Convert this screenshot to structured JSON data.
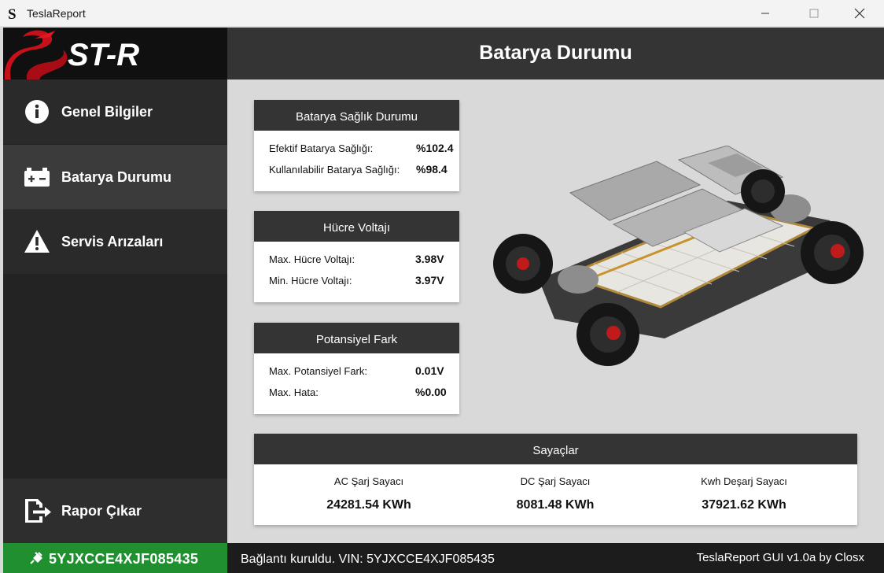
{
  "window": {
    "title": "TeslaReport"
  },
  "sidebar": {
    "logo_text": "ST-R",
    "items": [
      {
        "label": "Genel Bilgiler",
        "icon": "info-icon"
      },
      {
        "label": "Batarya Durumu",
        "icon": "battery-icon"
      },
      {
        "label": "Servis Arızaları",
        "icon": "warning-icon"
      }
    ],
    "report": {
      "label": "Rapor Çıkar",
      "icon": "export-icon"
    },
    "vin": {
      "label": "5YJXCCE4XJF085435",
      "icon": "plug-icon"
    }
  },
  "header": {
    "title": "Batarya Durumu"
  },
  "cards": {
    "health": {
      "title": "Batarya Sağlık Durumu",
      "rows": [
        {
          "label": "Efektif Batarya Sağlığı:",
          "value": "%102.4"
        },
        {
          "label": "Kullanılabilir Batarya Sağlığı:",
          "value": "%98.4"
        }
      ]
    },
    "voltage": {
      "title": "Hücre Voltajı",
      "rows": [
        {
          "label": "Max. Hücre Voltajı:",
          "value": "3.98V"
        },
        {
          "label": "Min. Hücre Voltajı:",
          "value": "3.97V"
        }
      ]
    },
    "potential": {
      "title": "Potansiyel Fark",
      "rows": [
        {
          "label": "Max. Potansiyel Fark:",
          "value": "0.01V"
        },
        {
          "label": "Max. Hata:",
          "value": "%0.00"
        }
      ]
    }
  },
  "counters": {
    "title": "Sayaçlar",
    "items": [
      {
        "label": "AC Şarj Sayacı",
        "value": "24281.54 KWh"
      },
      {
        "label": "DC Şarj Sayacı",
        "value": "8081.48 KWh"
      },
      {
        "label": "Kwh Deşarj Sayacı",
        "value": "37921.62 KWh"
      }
    ]
  },
  "status": {
    "left": "Bağlantı kuruldu. VIN: 5YJXCCE4XJF085435",
    "right": "TeslaReport GUI v1.0a by Closx"
  },
  "colors": {
    "accent_green": "#1f8f2f",
    "header_dark": "#343434",
    "sidebar_dark": "#232323",
    "logo_red": "#d0121b"
  }
}
